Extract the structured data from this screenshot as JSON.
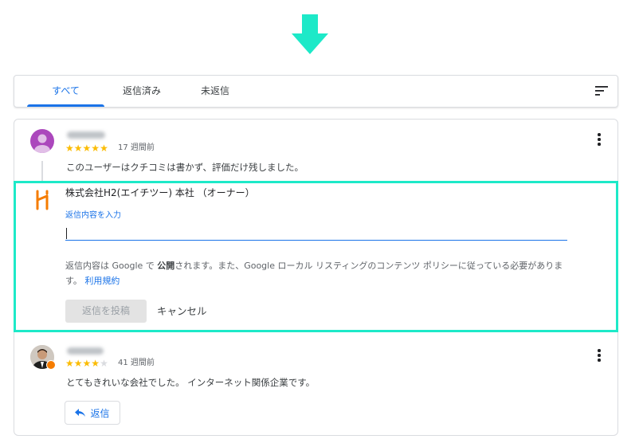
{
  "tabs": [
    {
      "label": "すべて",
      "active": true
    },
    {
      "label": "返信済み",
      "active": false
    },
    {
      "label": "未返信",
      "active": false
    }
  ],
  "icons": {
    "arrow": "down-arrow-icon",
    "sort": "sort-icon",
    "more": "more-vert-icon",
    "reply": "reply-arrow-icon"
  },
  "colors": {
    "accent": "#1a73e8",
    "highlight": "#1de9c8",
    "arrow": "#1de9c8",
    "star": "#fbbc04"
  },
  "reviews": [
    {
      "rating": 5,
      "max_rating": 5,
      "time": "17 週間前",
      "comment": "このユーザーはクチコミは書かず、評価だけ残しました。"
    },
    {
      "rating": 4,
      "max_rating": 5,
      "time": "41 週間前",
      "comment": "とてもきれいな会社でした。 インターネット関係企業です。",
      "reply_button": "返信"
    }
  ],
  "reply_form": {
    "owner_name": "株式会社H2(エイチツー) 本社 （オーナー）",
    "input_label": "返信内容を入力",
    "input_value": "",
    "notice_prefix": "返信内容は Google で",
    "notice_bold": "公開",
    "notice_suffix": "されます。また、Google ローカル リスティングのコンテンツ ポリシーに従っている必要があります。",
    "terms_link": "利用規約",
    "post_button": "返信を投稿",
    "cancel_button": "キャンセル"
  }
}
